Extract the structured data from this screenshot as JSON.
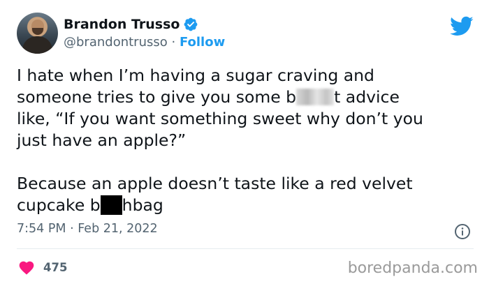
{
  "user": {
    "display_name": "Brandon Trusso",
    "handle": "@brandontrusso",
    "separator": "·",
    "follow_label": "Follow"
  },
  "tweet": {
    "line1": "I hate when I’m having a sugar craving and",
    "line2_before": "someone tries to give you some b",
    "line2_after": "t advice",
    "line3": "like, “If you want something sweet why don’t you",
    "line4": "just have an apple?”",
    "line6": "Because an apple doesn’t taste like a red velvet",
    "line7_before": "cupcake b",
    "line7_after": "hbag"
  },
  "meta": {
    "timestamp": "7:54 PM · Feb 21, 2022",
    "like_count": "475"
  },
  "watermark": "boredpanda.com",
  "colors": {
    "accent": "#1d9bf0",
    "like": "#f91880",
    "muted": "#536471"
  }
}
